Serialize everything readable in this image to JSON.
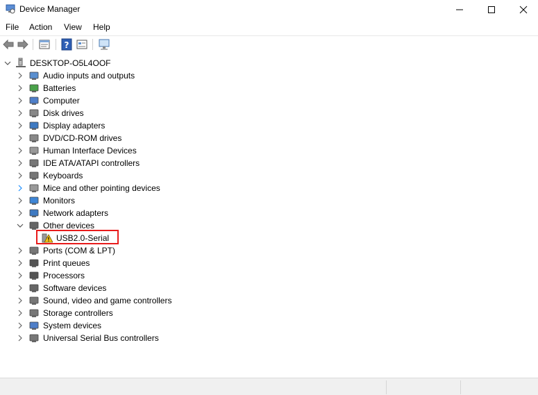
{
  "window": {
    "title": "Device Manager"
  },
  "menu": [
    {
      "id": "file",
      "label": "File"
    },
    {
      "id": "action",
      "label": "Action"
    },
    {
      "id": "view",
      "label": "View"
    },
    {
      "id": "help",
      "label": "Help"
    }
  ],
  "toolbar": {
    "buttons": [
      {
        "id": "back",
        "icon": "back-arrow-icon"
      },
      {
        "id": "forward",
        "icon": "forward-arrow-icon"
      },
      {
        "id": "properties",
        "icon": "properties-icon"
      },
      {
        "id": "help",
        "icon": "help-icon"
      },
      {
        "id": "view-toggle",
        "icon": "view-icon"
      },
      {
        "id": "scan",
        "icon": "scan-hardware-icon"
      }
    ]
  },
  "tree": {
    "root": "DESKTOP-O5L4OOF",
    "categories": [
      {
        "label": "Audio inputs and outputs",
        "icon": "speaker-icon"
      },
      {
        "label": "Batteries",
        "icon": "battery-icon"
      },
      {
        "label": "Computer",
        "icon": "computer-icon"
      },
      {
        "label": "Disk drives",
        "icon": "disk-drive-icon"
      },
      {
        "label": "Display adapters",
        "icon": "display-adapter-icon"
      },
      {
        "label": "DVD/CD-ROM drives",
        "icon": "dvd-icon"
      },
      {
        "label": "Human Interface Devices",
        "icon": "hid-icon"
      },
      {
        "label": "IDE ATA/ATAPI controllers",
        "icon": "ide-controller-icon"
      },
      {
        "label": "Keyboards",
        "icon": "keyboard-icon"
      },
      {
        "label": "Mice and other pointing devices",
        "icon": "mouse-icon"
      },
      {
        "label": "Monitors",
        "icon": "monitor-icon"
      },
      {
        "label": "Network adapters",
        "icon": "network-adapter-icon"
      },
      {
        "label": "Other devices",
        "icon": "unknown-device-icon",
        "expanded": true,
        "children": [
          {
            "label": "USB2.0-Serial",
            "icon": "warning-device-icon"
          }
        ]
      },
      {
        "label": "Ports (COM & LPT)",
        "icon": "port-icon"
      },
      {
        "label": "Print queues",
        "icon": "printer-icon"
      },
      {
        "label": "Processors",
        "icon": "processor-icon"
      },
      {
        "label": "Software devices",
        "icon": "software-device-icon"
      },
      {
        "label": "Sound, video and game controllers",
        "icon": "sound-controller-icon"
      },
      {
        "label": "Storage controllers",
        "icon": "storage-controller-icon"
      },
      {
        "label": "System devices",
        "icon": "system-device-icon"
      },
      {
        "label": "Universal Serial Bus controllers",
        "icon": "usb-icon"
      }
    ]
  },
  "colors": {
    "highlight": "#e81b1b",
    "selection_chevron": "#1e90ff"
  }
}
